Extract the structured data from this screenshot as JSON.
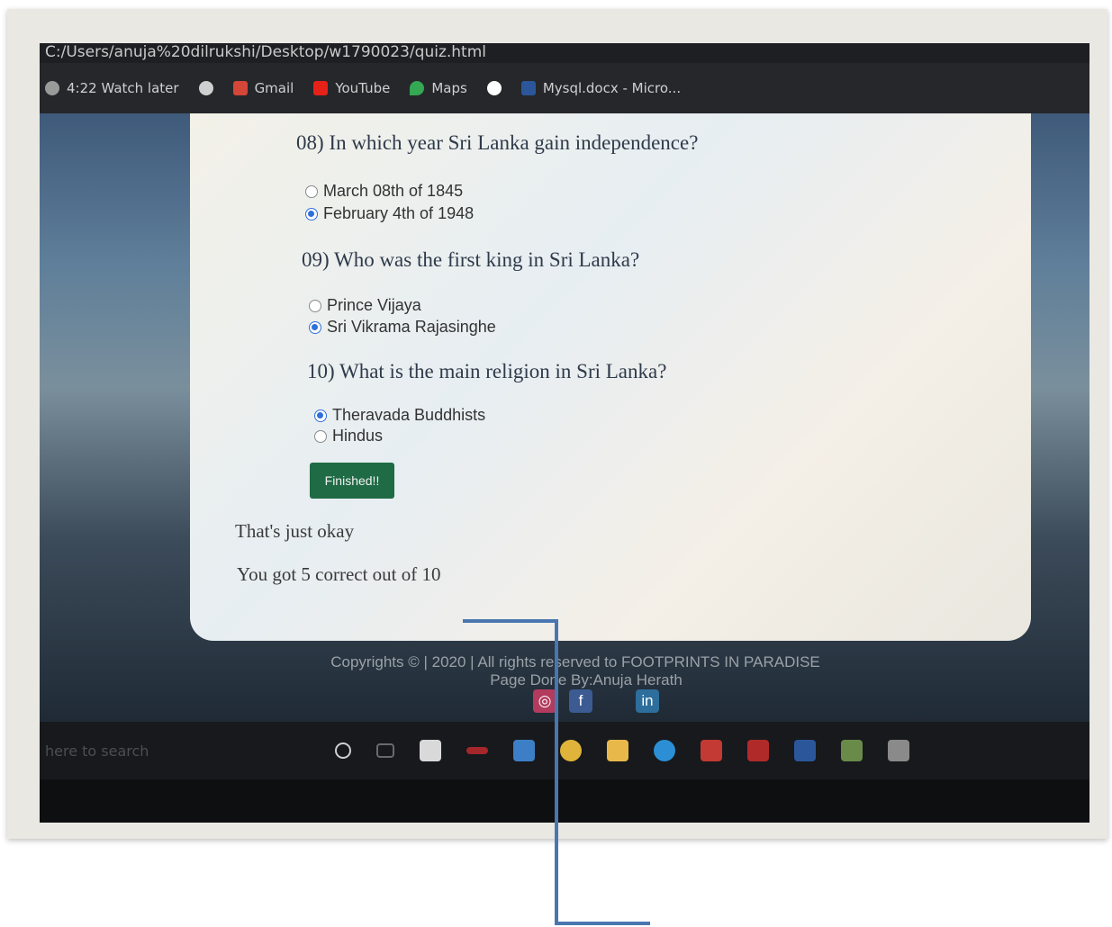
{
  "browser": {
    "address": "C:/Users/anuja%20dilrukshi/Desktop/w1790023/quiz.html",
    "bookmarks": [
      {
        "label": "4:22 Watch later",
        "icon": "watch-later-icon",
        "color": "#9a9a9a"
      },
      {
        "label": "",
        "icon": "globe-icon",
        "color": "#d0d0d0"
      },
      {
        "label": "Gmail",
        "icon": "gmail-icon",
        "color": "#d44638"
      },
      {
        "label": "YouTube",
        "icon": "youtube-icon",
        "color": "#e62117"
      },
      {
        "label": "Maps",
        "icon": "maps-icon",
        "color": "#34a853"
      },
      {
        "label": "",
        "icon": "google-icon",
        "color": "#ffffff"
      },
      {
        "label": "Mysql.docx - Micro...",
        "icon": "word-doc-icon",
        "color": "#2b579a"
      }
    ]
  },
  "quiz": {
    "questions": [
      {
        "text": "08) In which year Sri Lanka gain independence?",
        "options": [
          {
            "label": "March 08th of 1845",
            "checked": false
          },
          {
            "label": "February 4th of 1948",
            "checked": true
          }
        ]
      },
      {
        "text": "09) Who was the first king in Sri Lanka?",
        "options": [
          {
            "label": "Prince Vijaya",
            "checked": false
          },
          {
            "label": "Sri Vikrama Rajasinghe",
            "checked": true
          }
        ]
      },
      {
        "text": "10) What is the main religion in Sri Lanka?",
        "options": [
          {
            "label": "Theravada Buddhists",
            "checked": true
          },
          {
            "label": "Hindus",
            "checked": false
          }
        ]
      }
    ],
    "finish_label": "Finished!!",
    "result_message": "That's just okay",
    "score_text": "You got 5 correct out of 10"
  },
  "footer": {
    "copyright": "Copyrights © | 2020 | All rights reserved to FOOTPRINTS IN PARADISE",
    "credit": "Page Done By:Anuja Herath",
    "social": [
      {
        "icon": "instagram-icon",
        "glyph": "◎"
      },
      {
        "icon": "facebook-icon",
        "glyph": "f"
      },
      {
        "icon": "linkedin-icon",
        "glyph": "in"
      }
    ]
  },
  "taskbar": {
    "search_placeholder": "here to search"
  },
  "colors": {
    "accent": "#1f6b45",
    "connector": "#4a76b0"
  }
}
